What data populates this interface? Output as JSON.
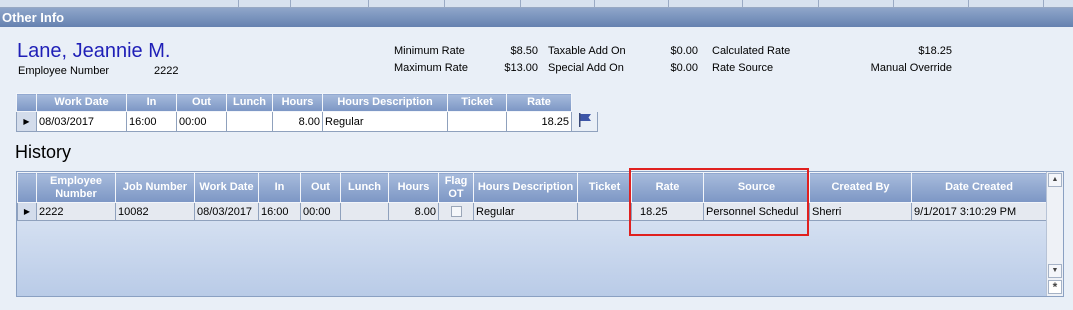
{
  "section": {
    "title": "Other Info"
  },
  "employee": {
    "name": "Lane, Jeannie M.",
    "number_label": "Employee Number",
    "number_value": "2222"
  },
  "rates": {
    "min_label": "Minimum Rate",
    "min_value": "$8.50",
    "max_label": "Maximum Rate",
    "max_value": "$13.00",
    "taxable_label": "Taxable Add On",
    "taxable_value": "$0.00",
    "special_label": "Special Add On",
    "special_value": "$0.00",
    "calc_label": "Calculated Rate",
    "calc_value": "$18.25",
    "source_label": "Rate Source",
    "source_value": "Manual Override"
  },
  "work_grid": {
    "headers": {
      "work_date": "Work Date",
      "in": "In",
      "out": "Out",
      "lunch": "Lunch",
      "hours": "Hours",
      "hours_desc": "Hours Description",
      "ticket": "Ticket",
      "rate": "Rate"
    },
    "row": {
      "work_date": "08/03/2017",
      "in": "16:00",
      "out": "00:00",
      "lunch": "",
      "hours": "8.00",
      "hours_desc": "Regular",
      "ticket": "",
      "rate": "18.25"
    },
    "flag_icon": "flag-icon"
  },
  "history": {
    "title": "History",
    "headers": {
      "employee_number": "Employee Number",
      "job_number": "Job Number",
      "work_date": "Work Date",
      "in": "In",
      "out": "Out",
      "lunch": "Lunch",
      "hours": "Hours",
      "flag_ot": "Flag OT",
      "hours_desc": "Hours Description",
      "ticket": "Ticket",
      "rate": "Rate",
      "source": "Source",
      "created_by": "Created By",
      "date_created": "Date Created"
    },
    "row": {
      "employee_number": "2222",
      "job_number": "10082",
      "work_date": "08/03/2017",
      "in": "16:00",
      "out": "00:00",
      "lunch": "",
      "hours": "8.00",
      "flag_ot": false,
      "hours_desc": "Regular",
      "ticket": "",
      "rate": "18.25",
      "source": "Personnel Schedul",
      "created_by": "Sherri",
      "date_created": "9/1/2017 3:10:29 PM"
    }
  },
  "colors": {
    "header_bar": "#6f89b6",
    "name_blue": "#1f1fb7",
    "highlight_red": "#e0201f"
  }
}
